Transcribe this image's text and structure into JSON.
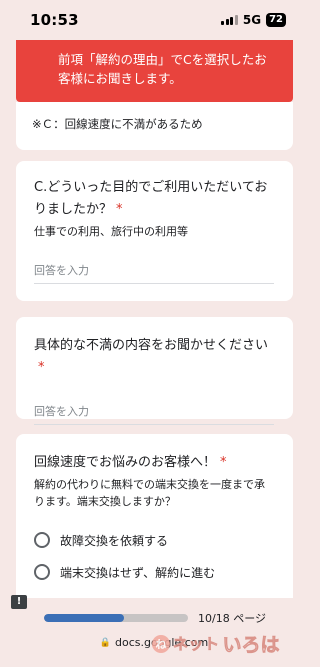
{
  "status_bar": {
    "time": "10:53",
    "network": "5G",
    "battery": "72"
  },
  "header": {
    "text": "前項「解約の理由」でCを選択したお客様にお聞きします。"
  },
  "note": {
    "text": "※Ｃ：回線速度に不満があるため"
  },
  "questions": [
    {
      "title": "C.どういった目的でご利用いただいておりましたか？",
      "required": "*",
      "description": "仕事での利用、旅行中の利用等",
      "placeholder": "回答を入力"
    },
    {
      "title": "具体的な不満の内容をお聞かせください",
      "required": "*",
      "placeholder": "回答を入力"
    },
    {
      "title": "回線速度でお悩みのお客様へ！",
      "required": "*",
      "description": "解約の代わりに無料での端末交換を一度まで承ります。端末交換しますか？",
      "options": [
        "故障交換を依頼する",
        "端末交換はせず、解約に進む"
      ]
    }
  ],
  "progress": {
    "fraction": 0.556,
    "page_label": "10/18 ページ"
  },
  "url": {
    "domain": "docs.google.com"
  },
  "watermark": {
    "text": "ネット",
    "text2": "いろは",
    "badge": "ね"
  },
  "icons": {
    "feedback": "feedback-icon",
    "lock": "lock-icon"
  }
}
